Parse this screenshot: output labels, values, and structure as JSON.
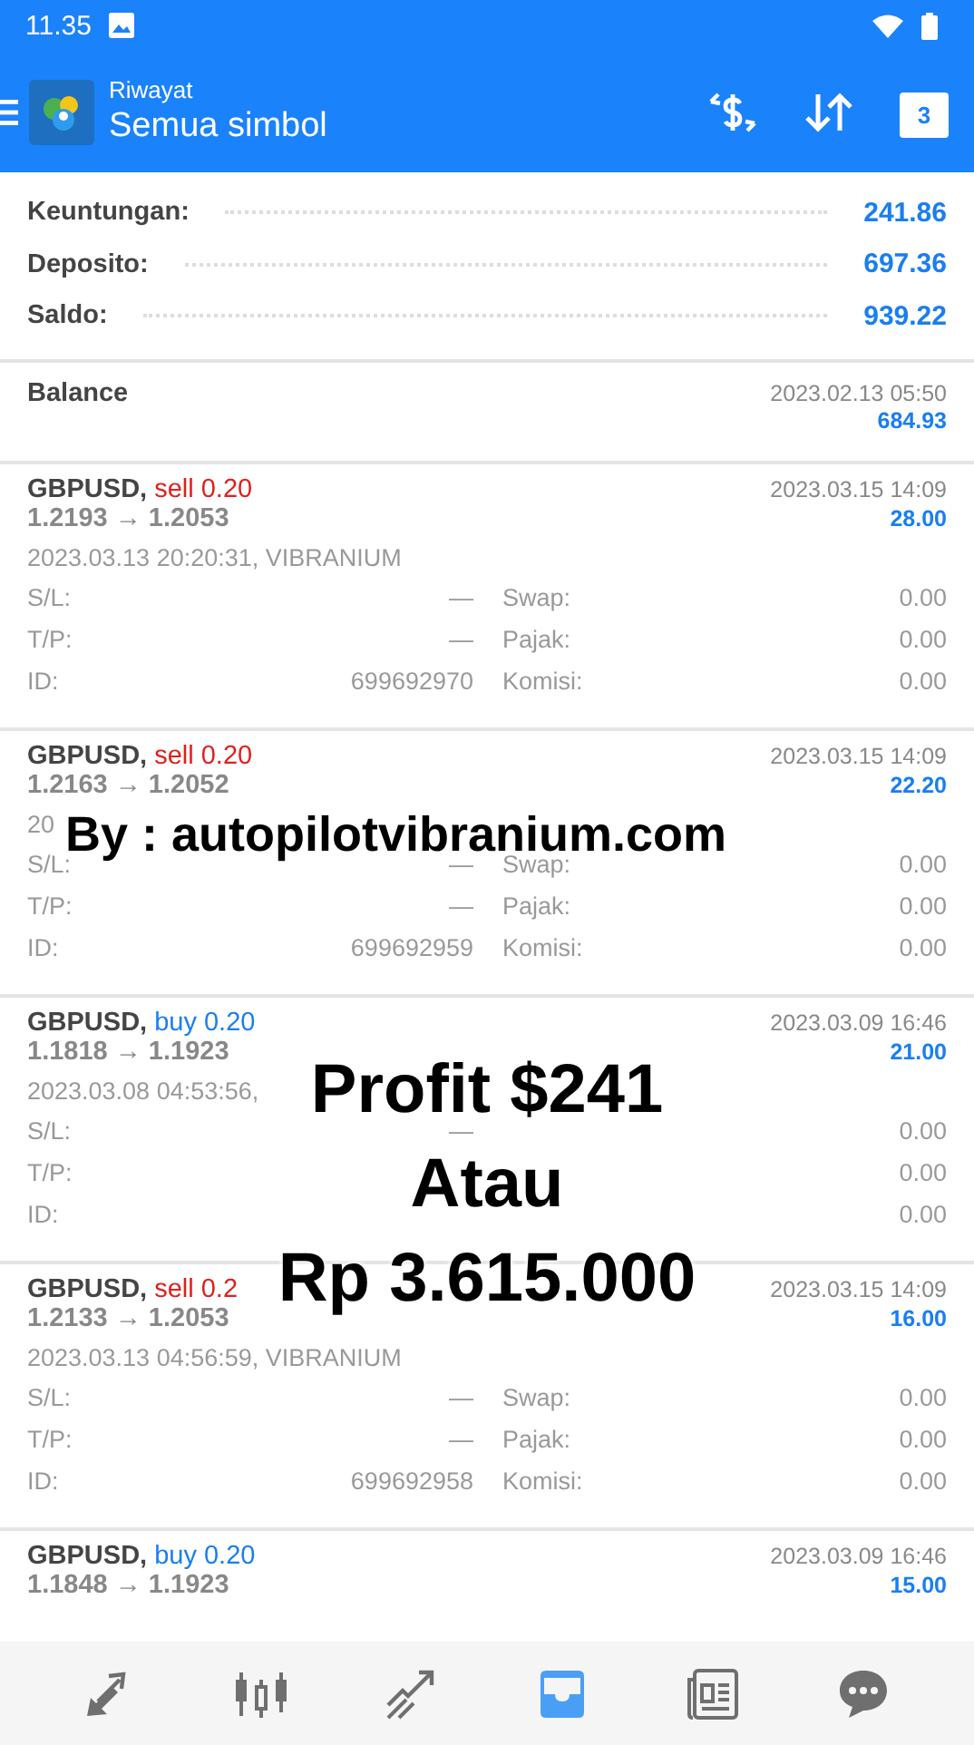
{
  "status_bar": {
    "time": "11.35"
  },
  "toolbar": {
    "subtitle": "Riwayat",
    "title": "Semua simbol",
    "calendar_day": "3"
  },
  "summary": [
    {
      "label": "Keuntungan:",
      "value": "241.86"
    },
    {
      "label": "Deposito:",
      "value": "697.36"
    },
    {
      "label": "Saldo:",
      "value": "939.22"
    }
  ],
  "balance": {
    "label": "Balance",
    "time": "2023.02.13 05:50",
    "amount": "684.93"
  },
  "trades": [
    {
      "symbol": "GBPUSD,",
      "kind": "sell",
      "side": "sell 0.20",
      "prices": "1.2193 → 1.2053",
      "time": "2023.03.15 14:09",
      "profit": "28.00",
      "opened": "2023.03.13 20:20:31, VIBRANIUM",
      "details": [
        {
          "label": "S/L:",
          "value": "—",
          "label2": "Swap:",
          "value2": "0.00"
        },
        {
          "label": "T/P:",
          "value": "—",
          "label2": "Pajak:",
          "value2": "0.00"
        },
        {
          "label": "ID:",
          "value": "699692970",
          "label2": "Komisi:",
          "value2": "0.00"
        }
      ]
    },
    {
      "symbol": "GBPUSD,",
      "kind": "sell",
      "side": "sell 0.20",
      "prices": "1.2163 → 1.2052",
      "time": "2023.03.15 14:09",
      "profit": "22.20",
      "opened": "20",
      "details": [
        {
          "label": "S/L:",
          "value": "—",
          "label2": "Swap:",
          "value2": "0.00"
        },
        {
          "label": "T/P:",
          "value": "—",
          "label2": "Pajak:",
          "value2": "0.00"
        },
        {
          "label": "ID:",
          "value": "699692959",
          "label2": "Komisi:",
          "value2": "0.00"
        }
      ]
    },
    {
      "symbol": "GBPUSD,",
      "kind": "buy",
      "side": "buy 0.20",
      "prices": "1.1818 → 1.1923",
      "time": "2023.03.09 16:46",
      "profit": "21.00",
      "opened": "2023.03.08 04:53:56,",
      "details": [
        {
          "label": "S/L:",
          "value": "—",
          "value2": "0.00"
        },
        {
          "label": "T/P:",
          "value2": "0.00"
        },
        {
          "label": "ID:",
          "value2": "0.00"
        }
      ]
    },
    {
      "symbol": "GBPUSD,",
      "kind": "sell",
      "side": "sell 0.2",
      "prices": "1.2133 → 1.2053",
      "time": "2023.03.15 14:09",
      "profit": "16.00",
      "opened": "2023.03.13 04:56:59, VIBRANIUM",
      "details": [
        {
          "label": "S/L:",
          "value": "—",
          "label2": "Swap:",
          "value2": "0.00"
        },
        {
          "label": "T/P:",
          "value": "—",
          "label2": "Pajak:",
          "value2": "0.00"
        },
        {
          "label": "ID:",
          "value": "699692958",
          "label2": "Komisi:",
          "value2": "0.00"
        }
      ]
    },
    {
      "symbol": "GBPUSD,",
      "kind": "buy",
      "side": "buy 0.20",
      "prices": "1.1848 → 1.1923",
      "time": "2023.03.09 16:46",
      "profit": "15.00"
    }
  ],
  "overlay_credit": "By : autopilotvibranium.com",
  "overlay_caption": [
    "Profit $241",
    "Atau",
    "Rp 3.615.000"
  ],
  "bottom_nav": [
    {
      "kind": "trade",
      "selected": false
    },
    {
      "kind": "chart",
      "selected": false
    },
    {
      "kind": "signals",
      "selected": false
    },
    {
      "kind": "history",
      "selected": true
    },
    {
      "kind": "news",
      "selected": false
    },
    {
      "kind": "chat",
      "selected": false
    }
  ]
}
